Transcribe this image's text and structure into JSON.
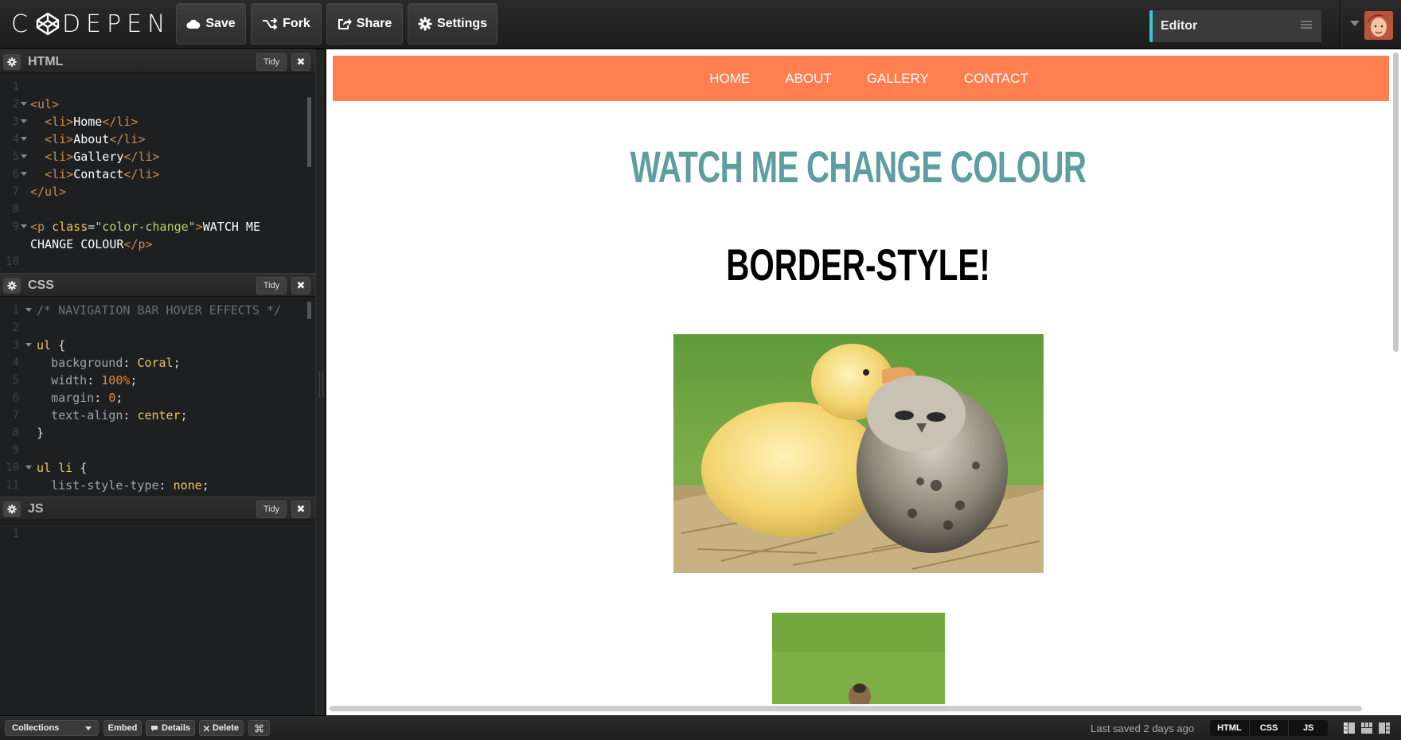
{
  "app": {
    "logo_text": "CODEPEN",
    "toolbar": {
      "save_label": "Save",
      "fork_label": "Fork",
      "share_label": "Share",
      "settings_label": "Settings"
    },
    "view_selector": {
      "value": "Editor"
    }
  },
  "panes": {
    "html": {
      "title": "HTML",
      "tidy_label": "Tidy",
      "close_label": "✖",
      "lines": [
        {
          "n": "1",
          "text": ""
        },
        {
          "n": "2",
          "text": "<ul>"
        },
        {
          "n": "3",
          "text": "  <li>Home</li>"
        },
        {
          "n": "4",
          "text": "  <li>About</li>"
        },
        {
          "n": "5",
          "text": "  <li>Gallery</li>"
        },
        {
          "n": "6",
          "text": "  <li>Contact</li>"
        },
        {
          "n": "7",
          "text": "</ul>"
        },
        {
          "n": "8",
          "text": ""
        },
        {
          "n": "9",
          "text": "<p class=\"color-change\">WATCH ME"
        },
        {
          "n": "",
          "text": "CHANGE COLOUR</p>"
        },
        {
          "n": "10",
          "text": ""
        }
      ]
    },
    "css": {
      "title": "CSS",
      "tidy_label": "Tidy",
      "close_label": "✖",
      "lines": [
        {
          "n": "1",
          "text": "/* NAVIGATION BAR HOVER EFFECTS */"
        },
        {
          "n": "2",
          "text": ""
        },
        {
          "n": "3",
          "text": "ul {"
        },
        {
          "n": "4",
          "text": "  background: Coral;"
        },
        {
          "n": "5",
          "text": "  width: 100%;"
        },
        {
          "n": "6",
          "text": "  margin: 0;"
        },
        {
          "n": "7",
          "text": "  text-align: center;"
        },
        {
          "n": "8",
          "text": "}"
        },
        {
          "n": "9",
          "text": ""
        },
        {
          "n": "10",
          "text": "ul li {"
        },
        {
          "n": "11",
          "text": "  list-style-type: none;"
        }
      ]
    },
    "js": {
      "title": "JS",
      "tidy_label": "Tidy",
      "close_label": "✖",
      "lines": [
        {
          "n": "1",
          "text": ""
        }
      ]
    }
  },
  "preview": {
    "nav": [
      "HOME",
      "ABOUT",
      "GALLERY",
      "CONTACT"
    ],
    "nav_color": "#FF7F50",
    "heading_color_change": "WATCH ME CHANGE COLOUR",
    "heading_color": "#5F9EA0",
    "heading_border": "BORDER-STYLE!"
  },
  "footer": {
    "collections_label": "Collections",
    "embed_label": "Embed",
    "details_label": "Details",
    "delete_label": "Delete",
    "last_saved": "Last saved 2 days ago",
    "view_tabs": [
      "HTML",
      "CSS",
      "JS"
    ]
  }
}
